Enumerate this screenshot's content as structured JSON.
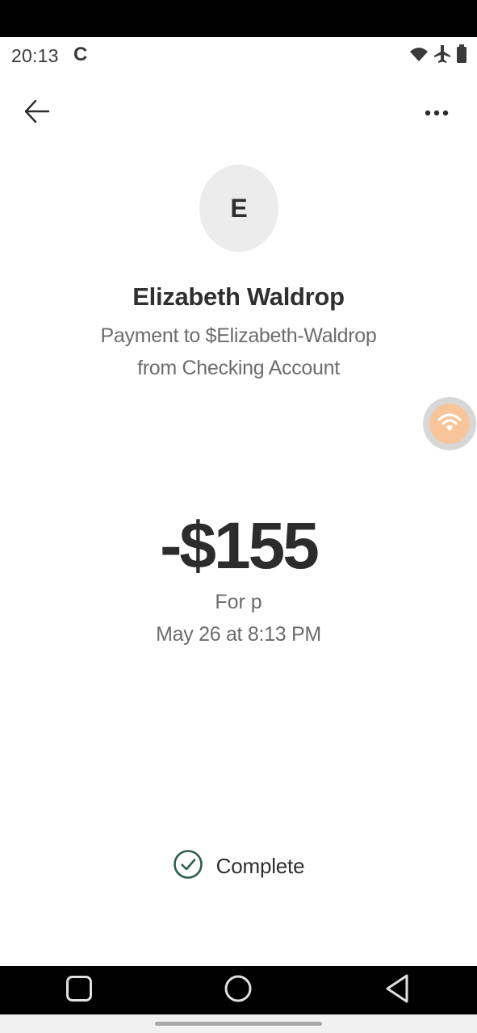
{
  "status_bar": {
    "time": "20:13",
    "carrier_indicator": "C",
    "icons": [
      "wifi-icon",
      "airplane-icon",
      "battery-icon"
    ]
  },
  "header": {
    "back_icon": "arrow-left-icon",
    "more_icon": "more-horizontal-icon"
  },
  "recipient": {
    "avatar_initial": "E",
    "name": "Elizabeth Waldrop",
    "description_line1": "Payment to $Elizabeth-Waldrop",
    "description_line2": "from Checking Account"
  },
  "transaction": {
    "amount": "-$155",
    "note": "For p",
    "datetime": "May 26 at 8:13 PM",
    "status": "Complete",
    "status_icon": "check-circle-icon"
  },
  "nav_bar": {
    "buttons": [
      "recents-square-icon",
      "home-circle-icon",
      "back-triangle-icon"
    ]
  },
  "colors": {
    "status_check": "#2f5d4b",
    "floating_accent": "#f8c59a"
  }
}
